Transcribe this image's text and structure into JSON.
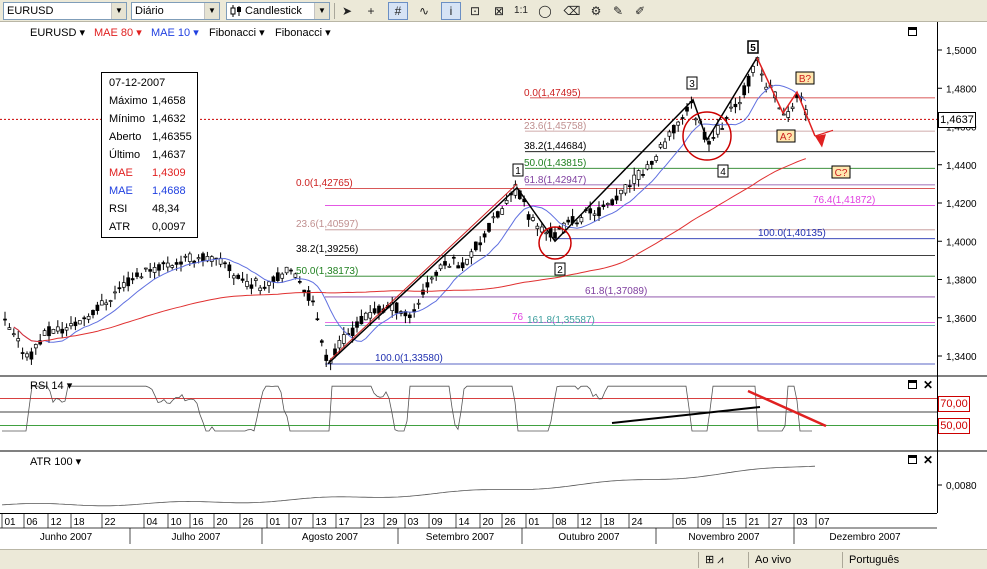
{
  "toolbar": {
    "symbol": "EURUSD",
    "period": "Diário",
    "chart_type": "Candlestick",
    "icons": [
      "cursor-icon",
      "crosshair-icon",
      "grid-icon",
      "wave-icon",
      "info-icon",
      "zoom-icon",
      "one-to-one-icon",
      "ellipse-icon",
      "eraser-icon",
      "settings-icon",
      "tools-icon"
    ],
    "one_to_one_label": "1:1"
  },
  "indicator_menu": [
    {
      "label": "EURUSD",
      "color": "#000000"
    },
    {
      "label": "MAE 80",
      "color": "#e02020"
    },
    {
      "label": "MAE 10",
      "color": "#2040e0"
    },
    {
      "label": "Fibonacci",
      "color": "#000000"
    },
    {
      "label": "Fibonacci",
      "color": "#000000"
    }
  ],
  "info": {
    "date": "07-12-2007",
    "rows": [
      {
        "label": "Máximo",
        "value": "1,4658",
        "color": "#000000"
      },
      {
        "label": "Mínimo",
        "value": "1,4632",
        "color": "#000000"
      },
      {
        "label": "Aberto",
        "value": "1,46355",
        "color": "#000000"
      },
      {
        "label": "Último",
        "value": "1,4637",
        "color": "#000000"
      },
      {
        "label": "MAE",
        "value": "1,4309",
        "color": "#e02020"
      },
      {
        "label": "MAE",
        "value": "1,4688",
        "color": "#2040e0"
      },
      {
        "label": "RSI",
        "value": "48,34",
        "color": "#000000"
      },
      {
        "label": "ATR",
        "value": "0,0097",
        "color": "#000000"
      }
    ]
  },
  "price_axis": {
    "ticks": [
      "1,5000",
      "1,4800",
      "1,4600",
      "1,4400",
      "1,4200",
      "1,4000",
      "1,3800",
      "1,3600",
      "1,3400"
    ],
    "current": "1,4637"
  },
  "fib_labels": [
    {
      "text": "0.0(1,47495)",
      "color": "#cc2020"
    },
    {
      "text": "23.6(1,45758)",
      "color": "#c09090"
    },
    {
      "text": "38.2(1,44684)",
      "color": "#000000"
    },
    {
      "text": "50.0(1,43815)",
      "color": "#208020"
    },
    {
      "text": "61.8(1,42947)",
      "color": "#8040a0"
    },
    {
      "text": "0.0(1,42765)",
      "color": "#cc2020"
    },
    {
      "text": "23.6(1,40597)",
      "color": "#c09090"
    },
    {
      "text": "38.2(1,39256)",
      "color": "#000000"
    },
    {
      "text": "50.0(1,38173)",
      "color": "#208020"
    },
    {
      "text": "61.8(1,37089)",
      "color": "#8040a0"
    },
    {
      "text": "76",
      "color": "#e040e0"
    },
    {
      "text": "161.8(1,35587)",
      "color": "#40a0a0"
    },
    {
      "text": "100.0(1,33580)",
      "color": "#2030b0"
    },
    {
      "text": "76.4(1,41872)",
      "color": "#e040e0"
    },
    {
      "text": "100.0(1,40135)",
      "color": "#2030b0"
    }
  ],
  "wave_labels": [
    "1",
    "2",
    "3",
    "4",
    "5",
    "A?",
    "B?",
    "C?"
  ],
  "rsi_panel": {
    "label": "RSI 14",
    "levels": [
      "70,00",
      "50,00"
    ]
  },
  "atr_panel": {
    "label": "ATR 100",
    "tick": "0,0080"
  },
  "x_axis": {
    "days": [
      "01",
      "06",
      "12",
      "18",
      "22",
      "04",
      "10",
      "16",
      "20",
      "26",
      "01",
      "07",
      "13",
      "17",
      "23",
      "29",
      "03",
      "09",
      "14",
      "20",
      "26",
      "01",
      "08",
      "12",
      "18",
      "24",
      "05",
      "09",
      "15",
      "21",
      "27",
      "03",
      "07"
    ],
    "months": [
      "Junho 2007",
      "Julho 2007",
      "Agosto 2007",
      "Setembro 2007",
      "Outubro 2007",
      "Novembro 2007",
      "Dezembro 2007"
    ]
  },
  "status": {
    "live": "Ao vivo",
    "language": "Português"
  },
  "colors": {
    "mae80": "#e02020",
    "mae10": "#2040e0",
    "rsi70": "#cc0000",
    "rsi50": "#000000",
    "rsi30": "#008000",
    "current_price": "#cc0000"
  }
}
